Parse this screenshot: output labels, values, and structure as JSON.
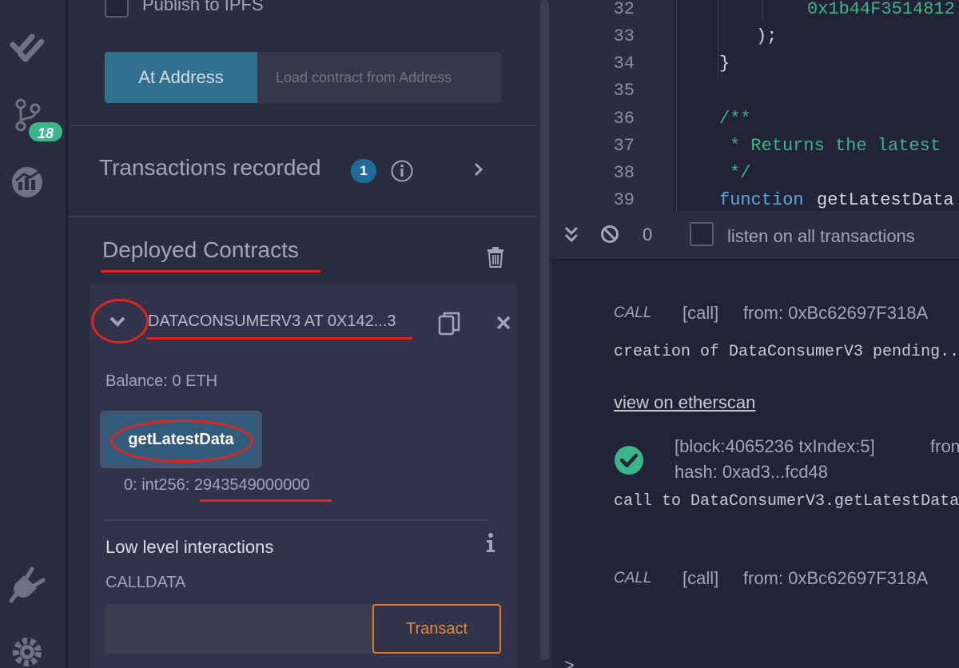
{
  "rail": {
    "badge": "18",
    "icons": [
      "double-check-icon",
      "git-branch-icon",
      "analytics-icon",
      "plug-icon",
      "gear-icon"
    ]
  },
  "panel": {
    "publish_ipfs_label": "Publish to IPFS",
    "at_address_label": "At Address",
    "at_address_placeholder": "Load contract from Address",
    "transactions_title": "Transactions recorded",
    "transactions_count": "1",
    "deployed_title": "Deployed Contracts",
    "instance": {
      "name": "DATACONSUMERV3 AT 0X142...3",
      "balance": "Balance: 0 ETH",
      "function_label": "getLatestData",
      "result": "0: int256: 2943549000000"
    },
    "low_level_title": "Low level interactions",
    "calldata_label": "CALLDATA",
    "transact_label": "Transact"
  },
  "editor": {
    "lines": [
      {
        "num": "32",
        "text": "0x1b44F3514812"
      },
      {
        "num": "33",
        "text": ");"
      },
      {
        "num": "34",
        "text": "}"
      },
      {
        "num": "35",
        "text": ""
      },
      {
        "num": "36",
        "text": "/**"
      },
      {
        "num": "37",
        "text": "* Returns the latest"
      },
      {
        "num": "38",
        "text": "*/"
      },
      {
        "num": "39",
        "keyword": "function",
        "text": "getLatestData"
      }
    ]
  },
  "terminal": {
    "count": "0",
    "listen_label": "listen on all transactions",
    "log1": {
      "tag": "CALL",
      "call": "[call]",
      "from": "from: 0xBc62697F318A"
    },
    "pending": "creation of DataConsumerV3 pending...",
    "etherscan": "view on etherscan",
    "block": "[block:4065236 txIndex:5]",
    "from_trunc": "from",
    "hash": "hash: 0xad3...fcd48",
    "call_to": "call to DataConsumerV3.getLatestData",
    "log2": {
      "tag": "CALL",
      "call": "[call]",
      "from": "from: 0xBc62697F318A"
    },
    "prompt": ">"
  }
}
